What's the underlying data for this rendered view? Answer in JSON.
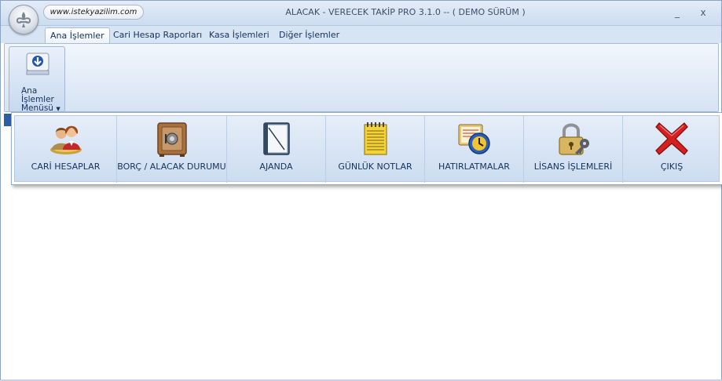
{
  "window": {
    "title": "ALACAK - VERECEK TAKİP PRO 3.1.0 -- ( DEMO SÜRÜM )",
    "url": "www.istekyazilim.com",
    "minimize": "_",
    "close": "x"
  },
  "tabs": [
    {
      "label": "Ana İşlemler"
    },
    {
      "label": "Cari Hesap Raporları"
    },
    {
      "label": "Kasa İşlemleri"
    },
    {
      "label": "Diğer İşlemler"
    }
  ],
  "ribbon": {
    "menu_button": {
      "line1": "Ana",
      "line2": "İşlemler",
      "line3": "Menüsü",
      "icon": "down-arrow-icon"
    }
  },
  "dropdown": {
    "items": [
      {
        "label": "CARİ HESAPLAR",
        "icon": "users-icon"
      },
      {
        "label": "BORÇ / ALACAK DURUMU",
        "icon": "safe-icon"
      },
      {
        "label": "AJANDA",
        "icon": "notebook-icon"
      },
      {
        "label": "GÜNLÜK NOTLAR",
        "icon": "notepad-icon"
      },
      {
        "label": "HATIRLATMALAR",
        "icon": "reminder-icon"
      },
      {
        "label": "LİSANS İŞLEMLERİ",
        "icon": "lock-key-icon"
      },
      {
        "label": "ÇIKIŞ",
        "icon": "exit-x-icon"
      }
    ]
  },
  "colors": {
    "accent": "#2a5ea8",
    "text": "#15325a",
    "exit_red": "#d62020"
  }
}
